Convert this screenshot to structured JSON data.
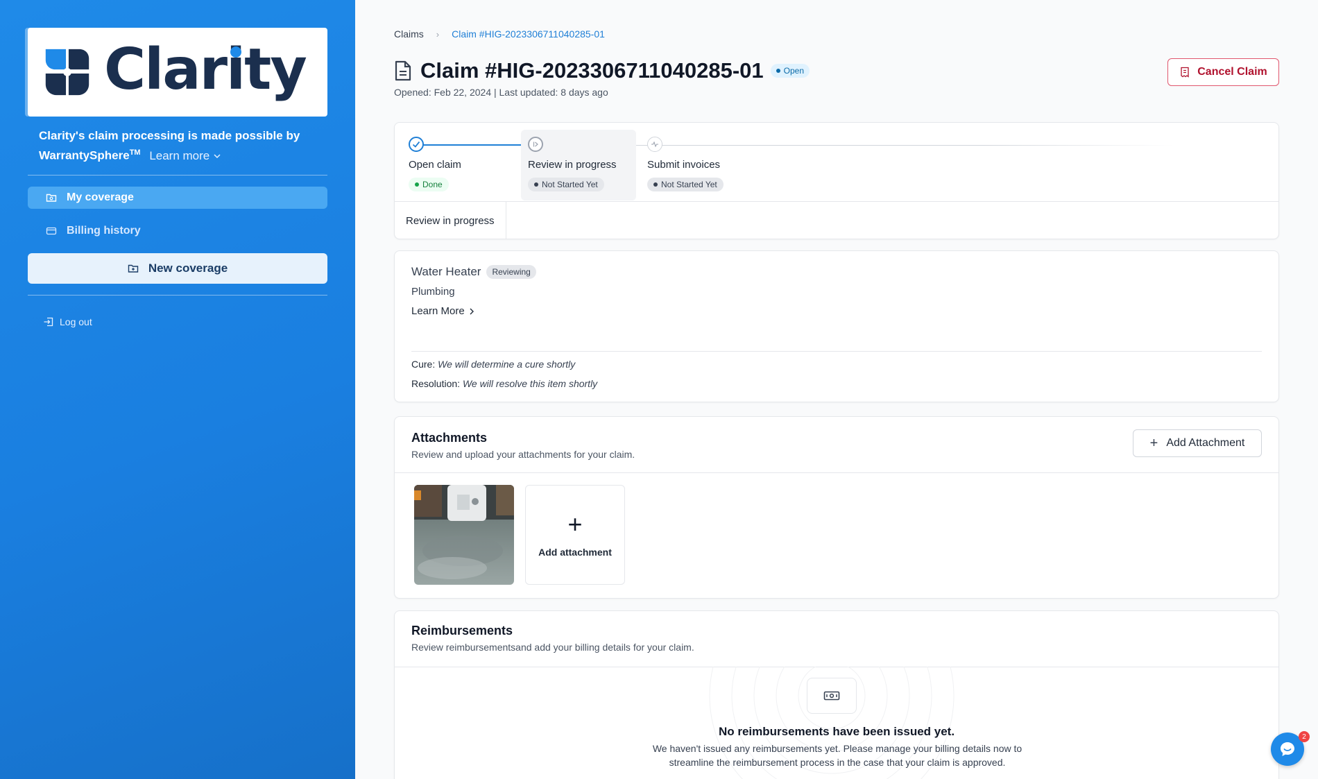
{
  "brand": {
    "logo_text": "Clarity",
    "powered_text": "Clarity's claim processing is made possible by WarrantySphere",
    "trademark": "TM",
    "learn_more": "Learn more",
    "colors": {
      "sidebar": "#1f8ae8",
      "logo_navy": "#1b2f4e"
    }
  },
  "sidebar": {
    "items": [
      {
        "label": "My coverage",
        "icon": "folder-icon",
        "active": true
      },
      {
        "label": "Billing history",
        "icon": "credit-card-icon",
        "active": false
      }
    ],
    "new_coverage": "New coverage",
    "logout": "Log out"
  },
  "breadcrumb": {
    "root": "Claims",
    "current": "Claim #HIG-2023306711040285-01"
  },
  "claim": {
    "title": "Claim #HIG-2023306711040285-01",
    "status": "Open",
    "meta": "Opened: Feb 22, 2024 | Last updated: 8 days ago",
    "cancel_label": "Cancel Claim"
  },
  "progress": {
    "steps": [
      {
        "label": "Open claim",
        "badge": "Done",
        "state": "done"
      },
      {
        "label": "Review in progress",
        "badge": "Not Started Yet",
        "state": "current"
      },
      {
        "label": "Submit invoices",
        "badge": "Not Started Yet",
        "state": "pending"
      }
    ],
    "tab_label": "Review in progress"
  },
  "item": {
    "name": "Water Heater",
    "status": "Reviewing",
    "category": "Plumbing",
    "learn_more": "Learn More",
    "cure_label": "Cure:",
    "cure_value": "We will determine a cure shortly",
    "resolution_label": "Resolution:",
    "resolution_value": "We will resolve this item shortly"
  },
  "attachments": {
    "title": "Attachments",
    "subtitle": "Review and upload your attachments for your claim.",
    "add_button": "Add Attachment",
    "add_tile": "Add attachment"
  },
  "reimbursements": {
    "title": "Reimbursements",
    "subtitle": "Review reimbursementsand add your billing details for your claim.",
    "empty_title": "No reimbursements have been issued yet.",
    "empty_desc": "We haven't issued any reimbursements yet. Please manage your billing details now to streamline the reimbursement process in the case that your claim is approved."
  },
  "chat": {
    "unread": "2"
  }
}
